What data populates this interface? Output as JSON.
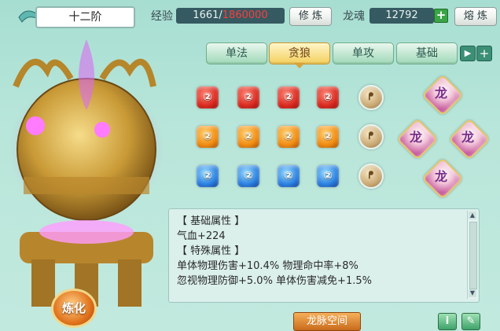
{
  "header": {
    "rank": "十二阶",
    "exp_label": "经验",
    "exp_current": "1661",
    "exp_sep": "/",
    "exp_max": "1860000",
    "cultivate_label": "修 炼",
    "soul_label": "龙魂",
    "soul_value": "12792",
    "smelt_label": "熔 炼"
  },
  "tabs": [
    {
      "label": "单法"
    },
    {
      "label": "贪狼"
    },
    {
      "label": "单攻"
    },
    {
      "label": "基础"
    }
  ],
  "gems": {
    "rows": [
      {
        "color": "#d8291f"
      },
      {
        "color": "#f08a10"
      },
      {
        "color": "#2a7fe0"
      }
    ],
    "glyph": "②",
    "bronze_glyph": "ᖰ",
    "star_glyph": "龙"
  },
  "attributes": {
    "base_header": "【 基础属性 】",
    "base_line1": "气血+224",
    "special_header": "【 特殊属性 】",
    "special_line1": "单体物理伤害+10.4%  物理命中率+8%",
    "special_line2": "忽视物理防御+5.0%  单体伤害减免+1.5%"
  },
  "buttons": {
    "refine": "炼化",
    "dragon_space": "龙脉空间",
    "info": "i",
    "edit": "✎"
  },
  "colors": {
    "exp_max_color": "#ff3b3b",
    "accent_tab": "#f3cf5e"
  }
}
